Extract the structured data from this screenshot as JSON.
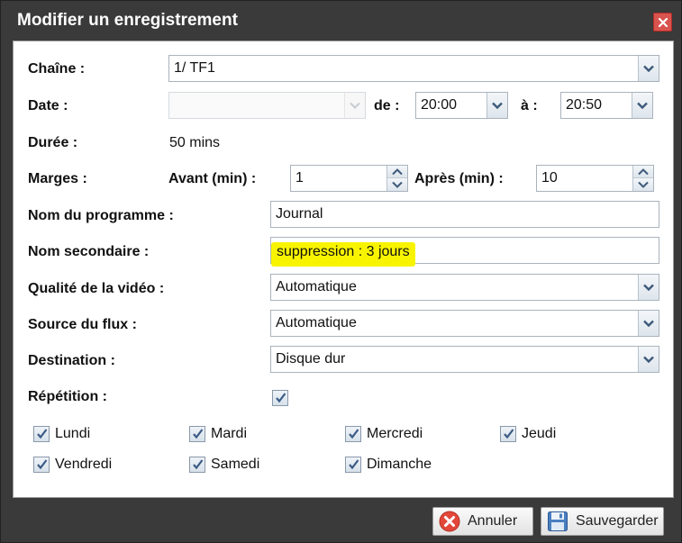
{
  "dialog": {
    "title": "Modifier un enregistrement",
    "close_icon": "close-icon",
    "accent_close": "#d9534f"
  },
  "form": {
    "chaine": {
      "label": "Chaîne :",
      "value": "1/ TF1"
    },
    "date": {
      "label": "Date :",
      "value": "",
      "de_label": "de :",
      "de_value": "20:00",
      "a_label": "à :",
      "a_value": "20:50"
    },
    "duree": {
      "label": "Durée :",
      "value": "50 mins"
    },
    "marges": {
      "label": "Marges :",
      "avant_label": "Avant (min) :",
      "avant_value": "1",
      "apres_label": "Après (min) :",
      "apres_value": "10"
    },
    "nom_programme": {
      "label": "Nom du programme :",
      "value": "Journal"
    },
    "nom_secondaire": {
      "label": "Nom secondaire :",
      "value": "suppression : 3 jours",
      "highlight_color": "#f8f400"
    },
    "qualite": {
      "label": "Qualité de la vidéo :",
      "value": "Automatique"
    },
    "source": {
      "label": "Source du flux :",
      "value": "Automatique"
    },
    "destination": {
      "label": "Destination :",
      "value": "Disque dur"
    },
    "repetition": {
      "label": "Répétition :",
      "checked": true
    },
    "days": [
      {
        "label": "Lundi",
        "checked": true
      },
      {
        "label": "Mardi",
        "checked": true
      },
      {
        "label": "Mercredi",
        "checked": true
      },
      {
        "label": "Jeudi",
        "checked": true
      },
      {
        "label": "Vendredi",
        "checked": true
      },
      {
        "label": "Samedi",
        "checked": true
      },
      {
        "label": "Dimanche",
        "checked": true
      }
    ]
  },
  "footer": {
    "cancel_label": "Annuler",
    "cancel_icon": "cancel-icon",
    "save_label": "Sauvegarder",
    "save_icon": "floppy-disk-icon"
  }
}
